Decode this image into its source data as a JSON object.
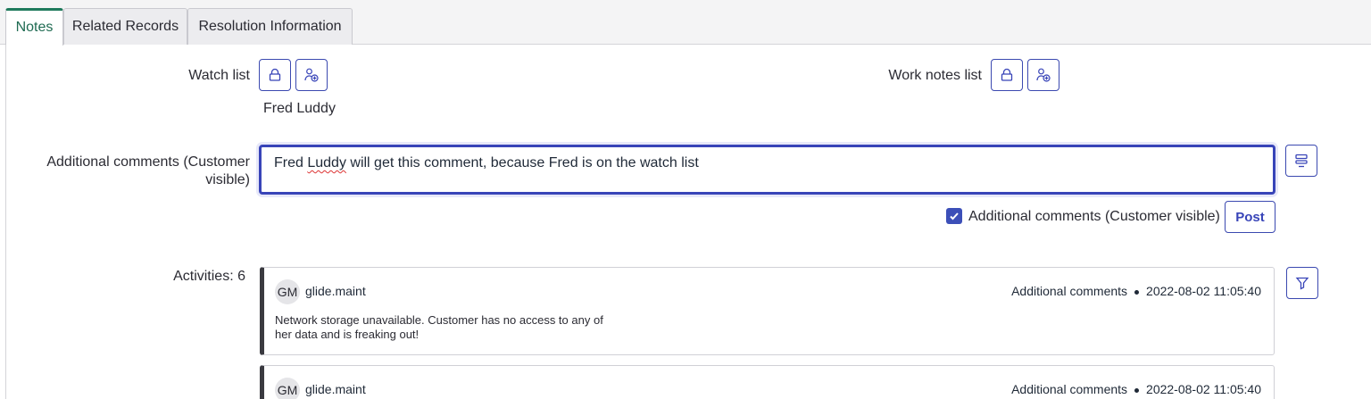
{
  "tabs": [
    {
      "label": "Notes",
      "active": true
    },
    {
      "label": "Related Records",
      "active": false
    },
    {
      "label": "Resolution Information",
      "active": false
    }
  ],
  "watch_list": {
    "label": "Watch list",
    "members": "Fred Luddy",
    "lock_icon": "lock-icon",
    "add_icon": "add-user-icon"
  },
  "work_notes_list": {
    "label": "Work notes list",
    "lock_icon": "lock-icon",
    "add_icon": "add-user-icon"
  },
  "additional_comments": {
    "label_line1": "Additional comments (Customer",
    "label_line2": "visible)",
    "value_prefix": "Fred ",
    "value_flagged_word": "Luddy",
    "value_suffix": " will get this comment, because Fred is on the watch list",
    "toggle_icon": "template-icon"
  },
  "post_controls": {
    "checkbox_label": "Additional comments (Customer visible)",
    "checkbox_checked": true,
    "post_label": "Post"
  },
  "activities": {
    "label": "Activities: 6",
    "filter_icon": "filter-icon",
    "items": [
      {
        "initials": "GM",
        "user": "glide.maint",
        "type": "Additional comments",
        "timestamp": "2022-08-02 11:05:40",
        "body_line1": "Network storage unavailable. Customer has no access to any of",
        "body_line2": "her data and is freaking out!"
      },
      {
        "initials": "GM",
        "user": "glide.maint",
        "type": "Additional comments",
        "timestamp": "2022-08-02 11:05:40"
      }
    ]
  },
  "colors": {
    "accent": "#3844b8",
    "active_tab": "#1f7a5c",
    "activity_bar": "#3a3a40"
  }
}
